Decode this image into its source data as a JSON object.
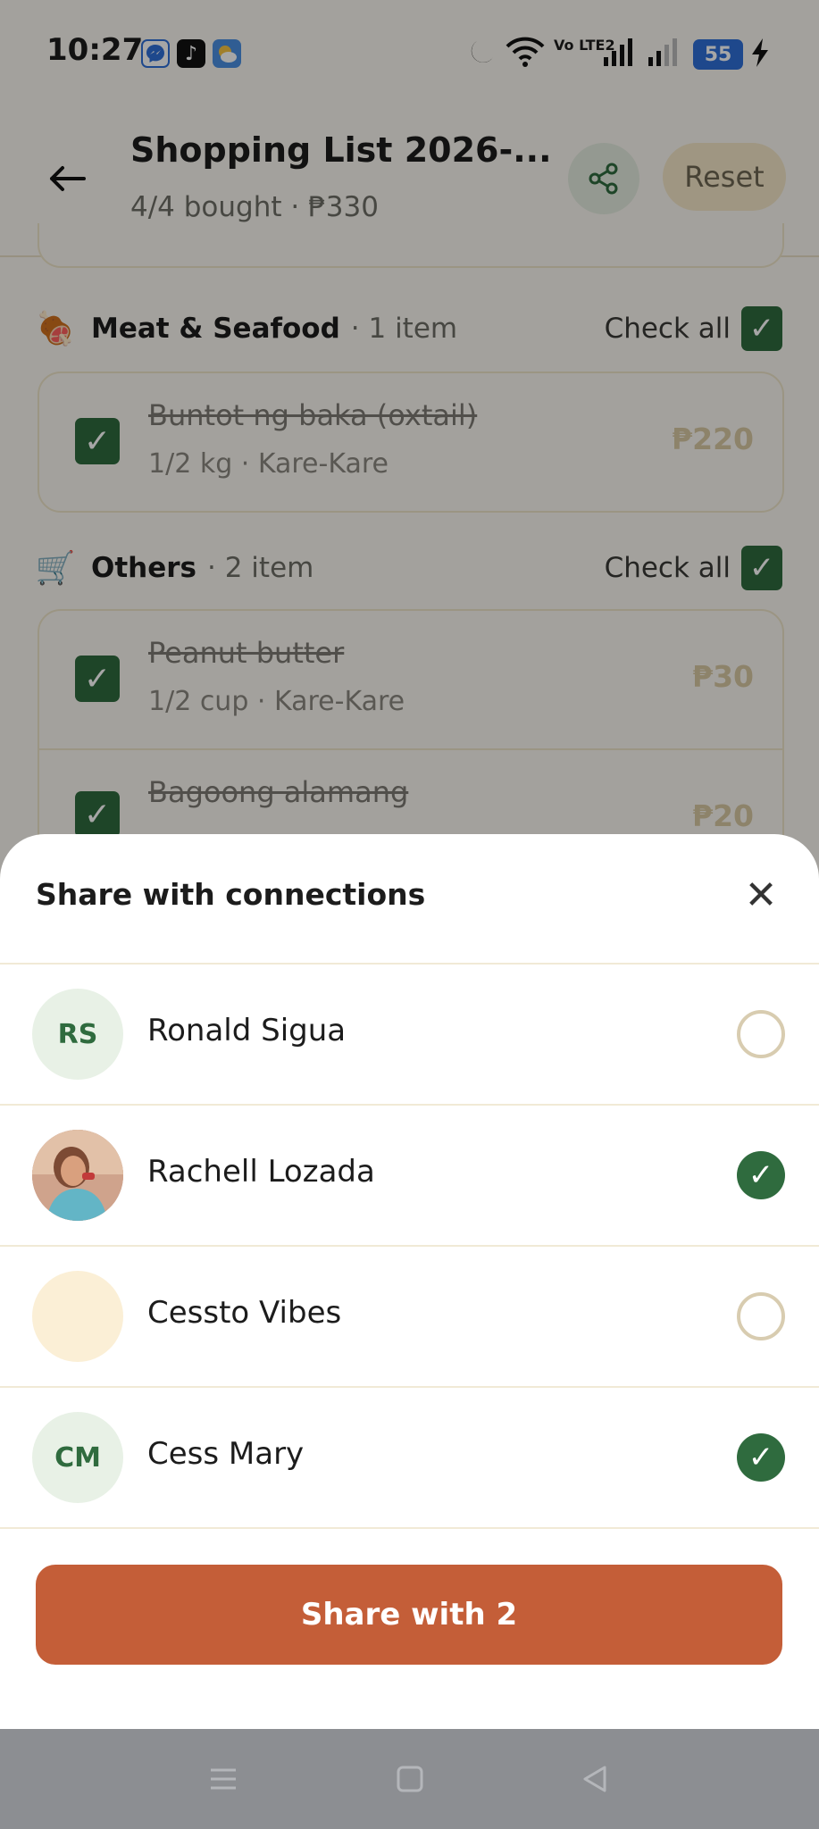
{
  "status_bar": {
    "time": "10:27",
    "battery": "55",
    "network_label": "Vo LTE2",
    "icons": [
      "messenger-icon",
      "tiktok-icon",
      "weather-icon",
      "moon-icon",
      "wifi-icon",
      "signal-icon",
      "signal-weak-icon",
      "charging-icon"
    ]
  },
  "header": {
    "title": "Shopping List 2026-...",
    "subtitle": "4/4 bought · ₱330",
    "reset_label": "Reset"
  },
  "sections": [
    {
      "name": "Meat & Seafood",
      "count": "· 1 item",
      "icon": "🍖",
      "check_all_label": "Check all",
      "items": [
        {
          "name": "Buntot ng baka (oxtail)",
          "meta": "1/2 kg · Kare-Kare",
          "price": "₱220",
          "checked": true
        }
      ]
    },
    {
      "name": "Others",
      "count": "· 2 item",
      "icon": "🛒",
      "check_all_label": "Check all",
      "items": [
        {
          "name": "Peanut butter",
          "meta": "1/2 cup · Kare-Kare",
          "price": "₱30",
          "checked": true
        },
        {
          "name": "Bagoong alamang",
          "meta": "",
          "price": "₱20",
          "checked": true
        }
      ]
    }
  ],
  "sheet": {
    "title": "Share with connections",
    "connections": [
      {
        "name": "Ronald Sigua",
        "initials": "RS",
        "selected": false
      },
      {
        "name": "Rachell Lozada",
        "initials": "",
        "selected": true
      },
      {
        "name": "Cessto Vibes",
        "initials": "",
        "selected": false
      },
      {
        "name": "Cess Mary",
        "initials": "CM",
        "selected": true
      }
    ],
    "share_button": "Share with 2"
  },
  "colors": {
    "accent_green": "#2f6b3e",
    "share_orange": "#c45e38",
    "background": "#fbf8f1"
  }
}
